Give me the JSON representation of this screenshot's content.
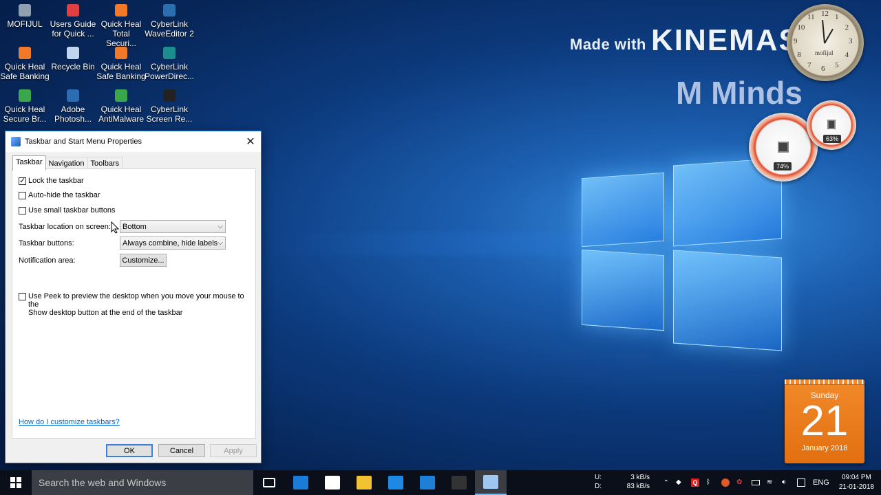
{
  "desktop_icons": [
    {
      "label": "MOFIJUL",
      "color": "#8fa0b0"
    },
    {
      "label": "Users Guide for Quick ...",
      "color": "#e04040"
    },
    {
      "label": "Quick Heal Total Securi...",
      "color": "#f07a2a"
    },
    {
      "label": "CyberLink WaveEditor 2",
      "color": "#2a6fb0"
    },
    {
      "label": "Quick Heal Safe Banking",
      "color": "#f07a2a"
    },
    {
      "label": "Recycle Bin",
      "color": "#c0d6ee"
    },
    {
      "label": "Quick Heal Safe Banking",
      "color": "#f07a2a"
    },
    {
      "label": "CyberLink PowerDirec...",
      "color": "#1c8c8c"
    },
    {
      "label": "Quick Heal Secure Br...",
      "color": "#3aa84a"
    },
    {
      "label": "Adobe Photosh...",
      "color": "#2b6cb3"
    },
    {
      "label": "Quick Heal AntiMalware",
      "color": "#3aa84a"
    },
    {
      "label": "CyberLink Screen Re...",
      "color": "#222222"
    }
  ],
  "watermark": {
    "made_with": "Made with",
    "kinemaster": "KINEMASTER",
    "m_minds": "M Minds"
  },
  "clock": {
    "brand": "mofijul",
    "numerals": [
      "12",
      "1",
      "2",
      "3",
      "4",
      "5",
      "6",
      "7",
      "8",
      "9",
      "10",
      "11"
    ]
  },
  "meters": {
    "cpu_percent": "74%",
    "ram_percent": "63%"
  },
  "calendar": {
    "weekday": "Sunday",
    "day": "21",
    "month_year": "January 2018"
  },
  "dialog": {
    "title": "Taskbar and Start Menu Properties",
    "tabs": [
      "Taskbar",
      "Navigation",
      "Toolbars"
    ],
    "active_tab": "Taskbar",
    "lock_taskbar": "Lock the taskbar",
    "auto_hide": "Auto-hide the taskbar",
    "small_buttons": "Use small taskbar buttons",
    "location_label": "Taskbar location on screen:",
    "location_value": "Bottom",
    "buttons_label": "Taskbar buttons:",
    "buttons_value": "Always combine, hide labels",
    "notification_label": "Notification area:",
    "customize": "Customize...",
    "peek_line1": "Use Peek to preview the desktop when you move your mouse to the",
    "peek_line2": "Show desktop button at the end of the taskbar",
    "help_link": "How do I customize taskbars?",
    "ok": "OK",
    "cancel": "Cancel",
    "apply": "Apply"
  },
  "taskbar": {
    "search_placeholder": "Search the web and Windows",
    "net_up_label": "U:",
    "net_down_label": "D:",
    "net_up": "3 kB/s",
    "net_down": "83 kB/s",
    "language": "ENG",
    "time": "09:04 PM",
    "date": "21-01-2018",
    "apps": [
      {
        "name": "task-view-icon",
        "color": "#0a0f1a"
      },
      {
        "name": "settings-icon",
        "color": "#1a7bd8"
      },
      {
        "name": "camera-icon",
        "color": "#ffffff"
      },
      {
        "name": "file-explorer-icon",
        "color": "#f2c233"
      },
      {
        "name": "messenger-icon",
        "color": "#1e88e5"
      },
      {
        "name": "edge-icon",
        "color": "#1e7fd6"
      },
      {
        "name": "screen-recorder-icon",
        "color": "#333333"
      },
      {
        "name": "taskbar-properties-icon",
        "color": "#9fc8f0"
      }
    ]
  }
}
